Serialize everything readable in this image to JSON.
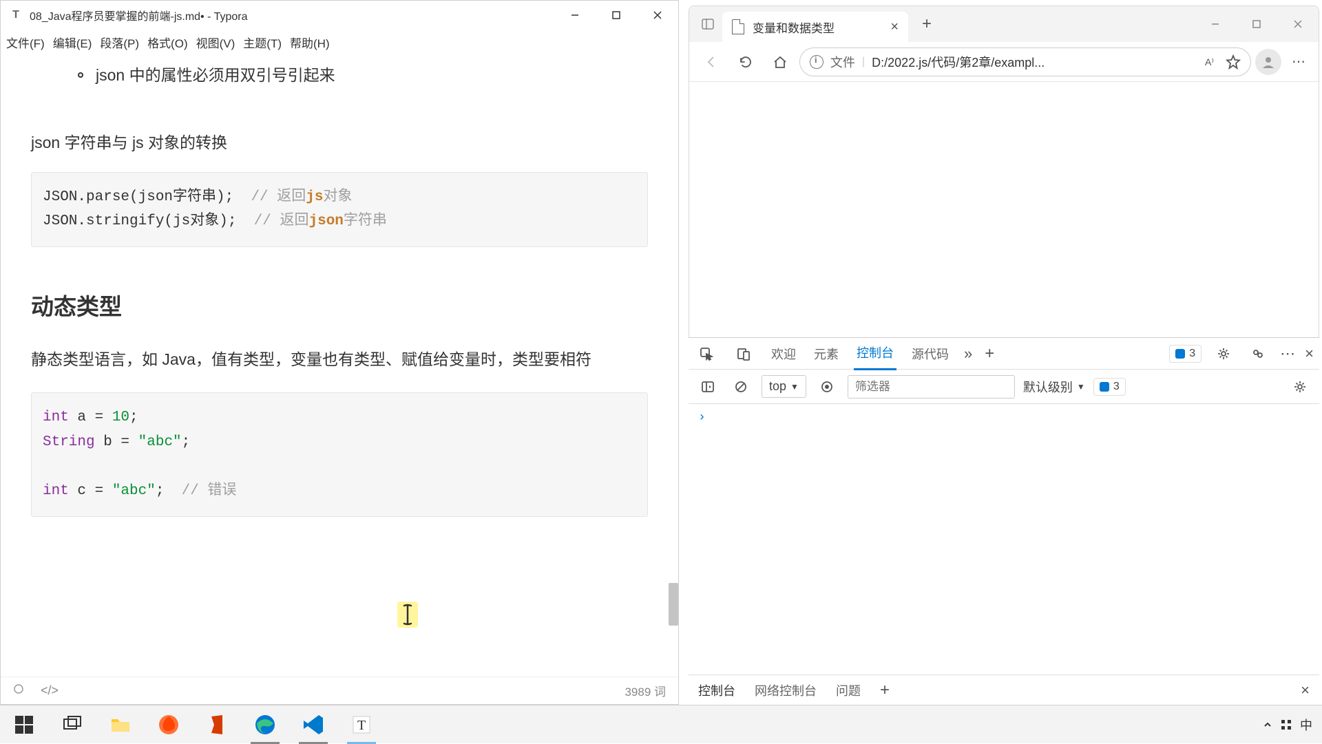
{
  "typora": {
    "title": "08_Java程序员要掌握的前端-js.md• - Typora",
    "menu": [
      "文件(F)",
      "编辑(E)",
      "段落(P)",
      "格式(O)",
      "视图(V)",
      "主题(T)",
      "帮助(H)"
    ],
    "bullet_text": "json 中的属性必须用双引号引起来",
    "section1": "json 字符串与 js 对象的转换",
    "code1": {
      "line1a": "JSON.parse(json",
      "line1b": "字符串);  ",
      "line1c": "// 返回",
      "line1d": "js",
      "line1e": "对象",
      "line2a": "JSON.stringify(js",
      "line2b": "对象);  ",
      "line2c": "// 返回",
      "line2d": "json",
      "line2e": "字符串"
    },
    "h2": "动态类型",
    "para": "静态类型语言，如 Java，值有类型，变量也有类型、赋值给变量时，类型要相符",
    "code2": {
      "l1_type": "int",
      "l1_rest": " a = ",
      "l1_num": "10",
      "l1_end": ";",
      "l2_type": "String",
      "l2_rest": " b = ",
      "l2_str": "\"abc\"",
      "l2_end": ";",
      "l3_type": "int",
      "l3_rest": " c = ",
      "l3_str": "\"abc\"",
      "l3_end": ";  ",
      "l3_comment": "// 错误"
    },
    "word_count": "3989 词"
  },
  "edge": {
    "tab_title": "变量和数据类型",
    "addr_label": "文件",
    "addr_url": "D:/2022.js/代码/第2章/exampl..."
  },
  "devtools": {
    "tabs": [
      "欢迎",
      "元素",
      "控制台",
      "源代码"
    ],
    "active_tab": "控制台",
    "badge_count": "3",
    "context": "top",
    "filter_placeholder": "筛选器",
    "level": "默认级别",
    "issues": "3",
    "drawer": [
      "控制台",
      "网络控制台",
      "问题"
    ]
  },
  "tray": {
    "ime": "中"
  }
}
